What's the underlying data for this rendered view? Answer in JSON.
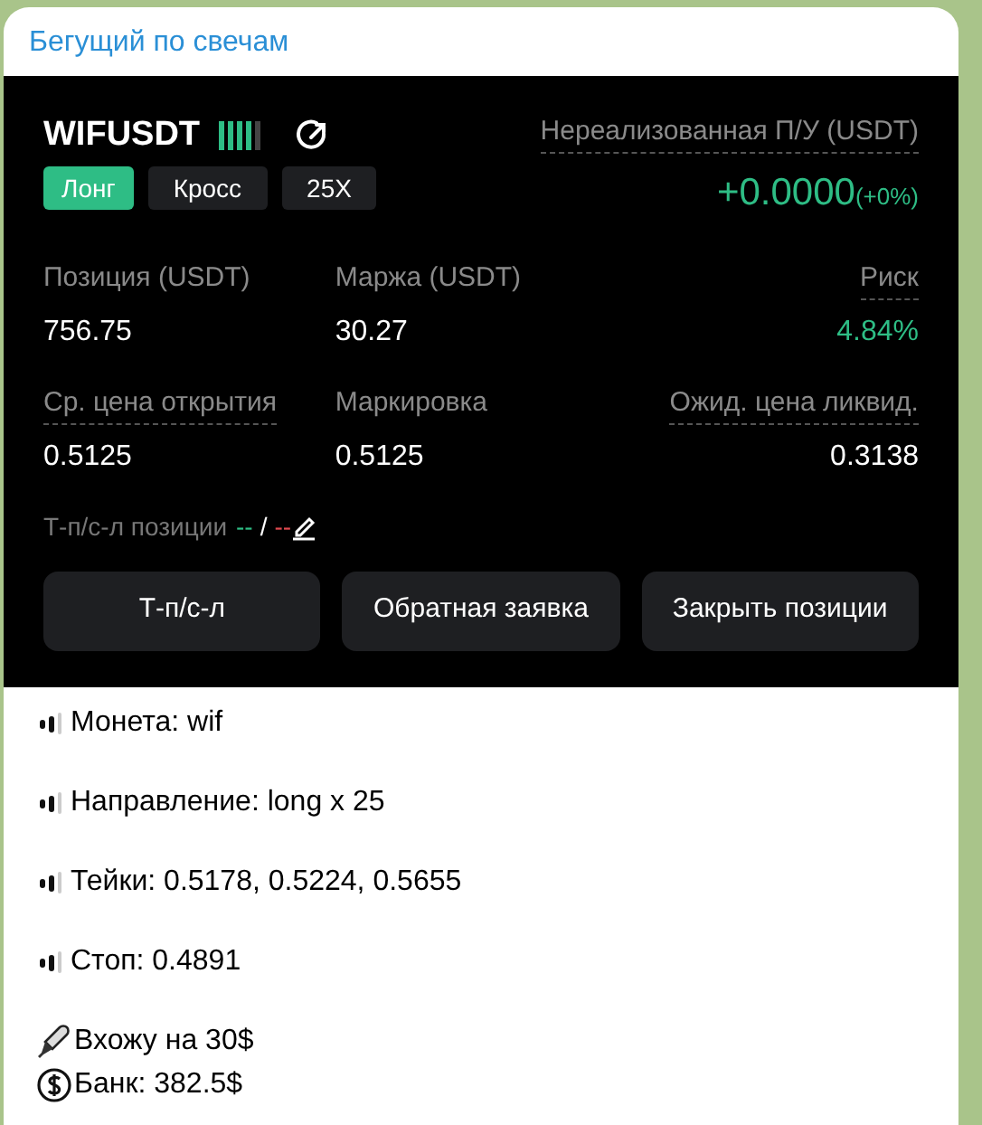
{
  "channel": {
    "title": "Бегущий по свечам"
  },
  "position": {
    "symbol": "WIFUSDT",
    "tags": [
      {
        "label": "Лонг",
        "kind": "side"
      },
      {
        "label": "Кросс",
        "kind": "plain"
      },
      {
        "label": "25X",
        "kind": "plain"
      }
    ],
    "pnl_label": "Нереализованная П/У (USDT)",
    "pnl_value": "+0.0000",
    "pnl_percent": "(+0%)",
    "stats": [
      {
        "label": "Позиция (USDT)",
        "value": "756.75",
        "dotted": false,
        "color": "#ffffff"
      },
      {
        "label": "Маржа (USDT)",
        "value": "30.27",
        "dotted": false,
        "color": "#ffffff"
      },
      {
        "label": "Риск",
        "value": "4.84%",
        "dotted": true,
        "color": "#2ebd85"
      },
      {
        "label": "Ср. цена открытия",
        "value": "0.5125",
        "dotted": true,
        "color": "#ffffff"
      },
      {
        "label": "Маркировка",
        "value": "0.5125",
        "dotted": false,
        "color": "#ffffff"
      },
      {
        "label": "Ожид. цена ликвид.",
        "value": "0.3138",
        "dotted": true,
        "color": "#ffffff"
      }
    ],
    "tpsl": {
      "label": "Т-п/с-л позиции",
      "tp": "--",
      "separator": "/",
      "sl": "--"
    },
    "buttons": [
      "Т-п/с-л",
      "Обратная заявка",
      "Закрыть позиции"
    ]
  },
  "message": [
    {
      "kind": "bullet",
      "text": "Монета: wif"
    },
    {
      "kind": "bullet",
      "text": "Направление: long x 25"
    },
    {
      "kind": "bullet",
      "text": "Тейки: 0.5178, 0.5224, 0.5655"
    },
    {
      "kind": "bullet",
      "text": "Стоп: 0.4891"
    },
    {
      "kind": "pen",
      "text": "Вхожу на 30$"
    },
    {
      "kind": "dollar",
      "text": "Банк: 382.5$"
    }
  ]
}
